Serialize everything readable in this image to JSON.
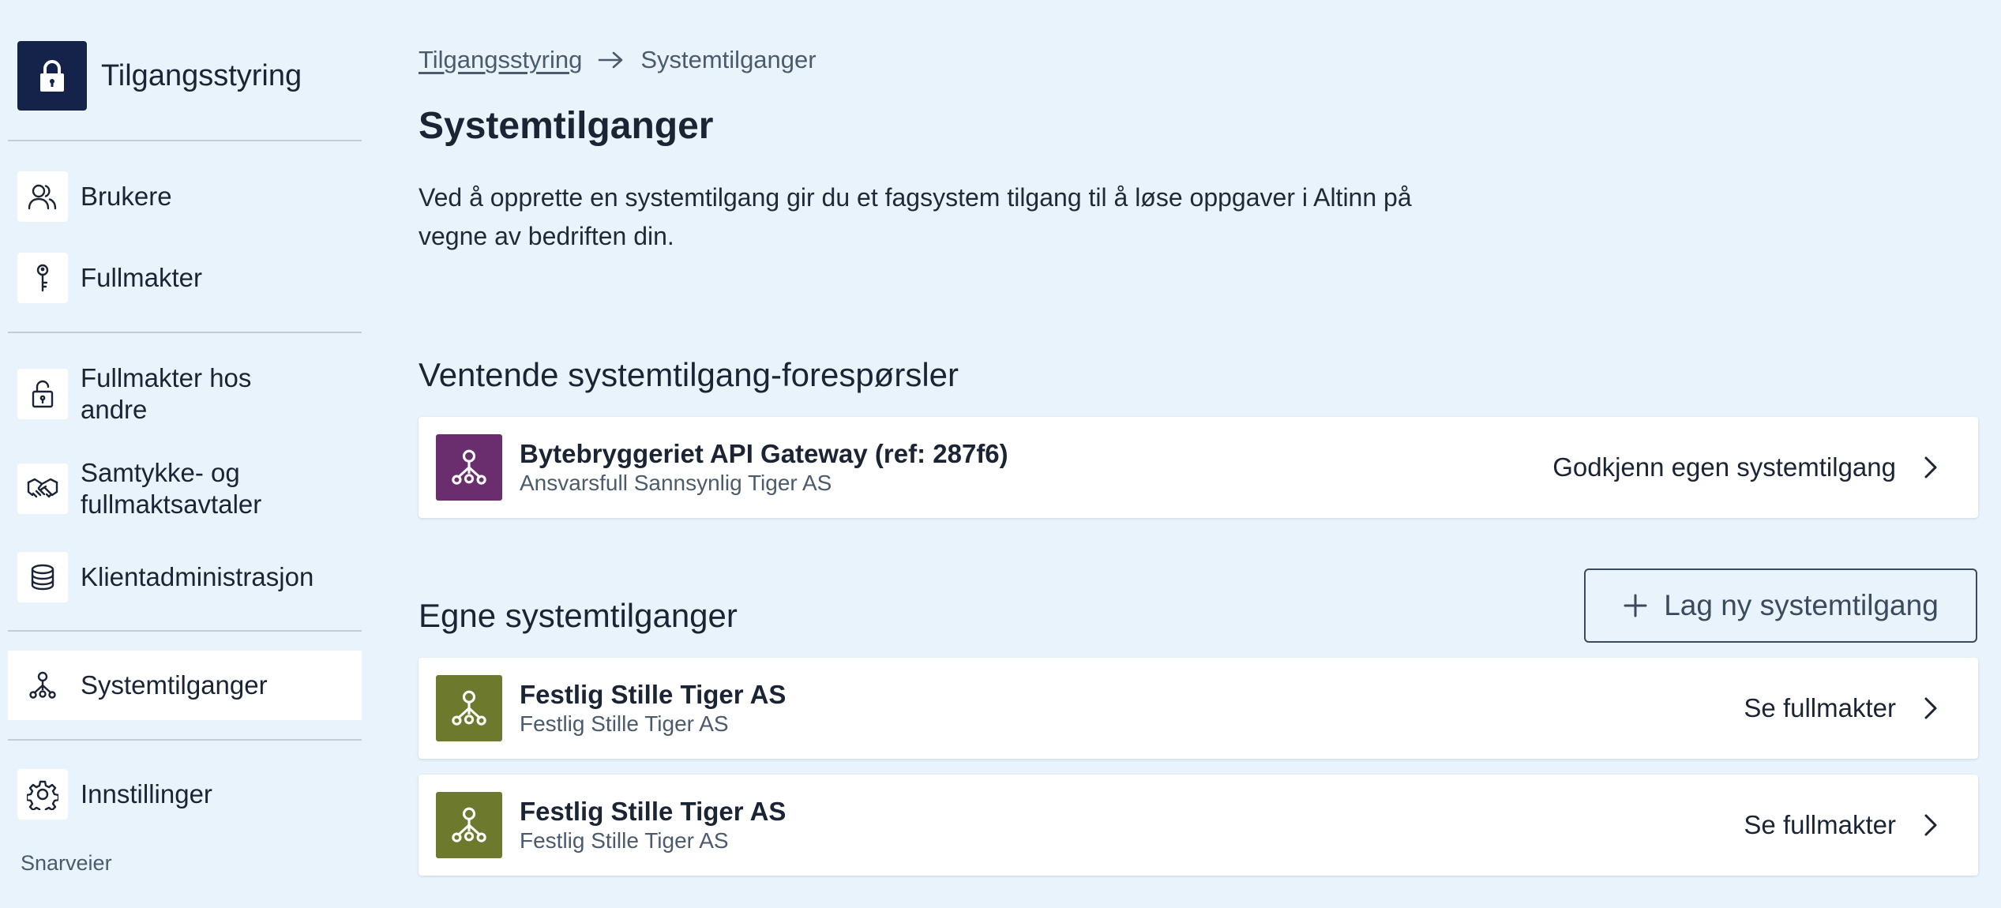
{
  "sidebar": {
    "brand": {
      "title": "Tilgangsstyring",
      "icon": "lock-icon",
      "icon_bg": "#15234a"
    },
    "items": [
      {
        "label": "Brukere",
        "icon": "users-icon"
      },
      {
        "label": "Fullmakter",
        "icon": "key-icon"
      },
      {
        "label": "Fullmakter hos\nandre",
        "icon": "padlock-open-icon"
      },
      {
        "label": "Samtykke- og\nfullmaktsavtaler",
        "icon": "handshake-icon"
      },
      {
        "label": "Klientadministrasjon",
        "icon": "database-icon"
      },
      {
        "label": "Systemtilganger",
        "icon": "system-network-icon",
        "active": true
      },
      {
        "label": "Innstillinger",
        "icon": "gear-icon"
      }
    ],
    "shortcuts_label": "Snarveier"
  },
  "breadcrumb": {
    "parent": "Tilgangsstyring",
    "current": "Systemtilganger"
  },
  "page": {
    "title": "Systemtilganger",
    "intro": "Ved å opprette en systemtilgang gir du et fagsystem tilgang til å løse oppgaver i Altinn på vegne av bedriften din."
  },
  "pending": {
    "title": "Ventende systemtilgang-forespørsler",
    "items": [
      {
        "title": "Bytebryggeriet API Gateway (ref: 287f6)",
        "subtitle": "Ansvarsfull Sannsynlig Tiger AS",
        "action": "Godkjenn egen systemtilgang",
        "icon_color": "#6a2e6e"
      }
    ]
  },
  "own": {
    "title": "Egne systemtilganger",
    "new_button": "Lag ny systemtilgang",
    "items": [
      {
        "title": "Festlig Stille Tiger AS",
        "subtitle": "Festlig Stille Tiger AS",
        "action": "Se fullmakter",
        "icon_color": "#6d7a2e"
      },
      {
        "title": "Festlig Stille Tiger AS",
        "subtitle": "Festlig Stille Tiger AS",
        "action": "Se fullmakter",
        "icon_color": "#6d7a2e"
      }
    ]
  },
  "colors": {
    "background": "#e8f3fc",
    "text": "#1b2434",
    "muted": "#4b5a6c"
  }
}
